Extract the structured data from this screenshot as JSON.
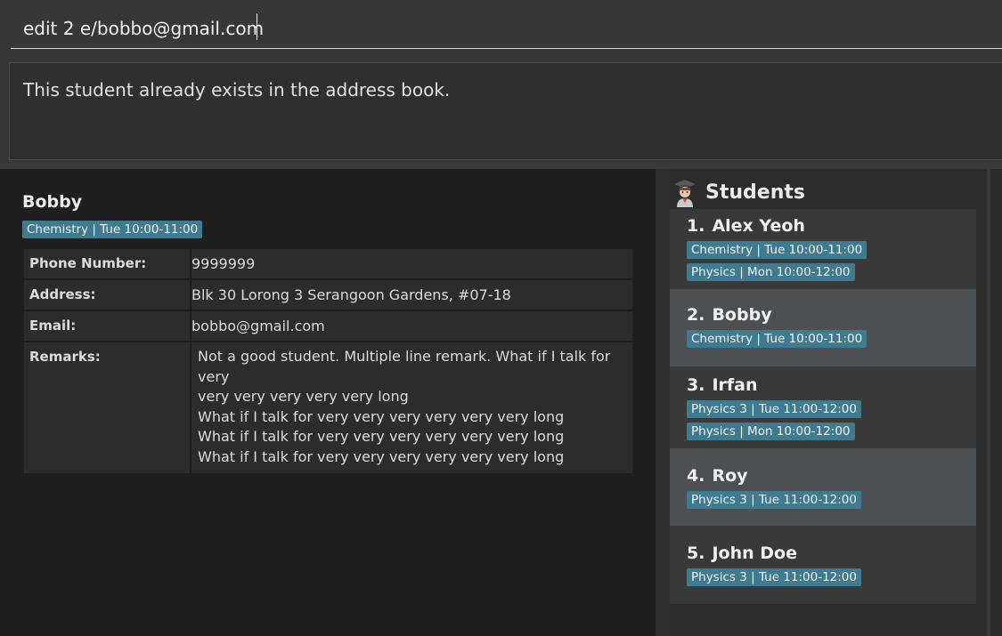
{
  "command": {
    "value": "edit 2 e/bobbo@gmail.com"
  },
  "result": {
    "message": "This student already exists in the address book."
  },
  "details": {
    "name": "Bobby",
    "tag": "Chemistry | Tue 10:00-11:00",
    "rows": [
      {
        "label": "Phone Number:",
        "value": "9999999"
      },
      {
        "label": "Address:",
        "value": "Blk 30 Lorong 3 Serangoon Gardens, #07-18"
      },
      {
        "label": "Email:",
        "value": "bobbo@gmail.com"
      }
    ],
    "remarks_label": "Remarks:",
    "remarks_lines": [
      "Not a good student. Multiple line remark. What if I talk for very",
      "very very very very very long",
      "What if I talk for very very very very very very long",
      "What if I talk for very very very very very very long",
      "What if I talk for very very very very very very long"
    ]
  },
  "students": {
    "title": "Students",
    "icon": "graduate-student-icon",
    "items": [
      {
        "index": "1.",
        "name": "Alex Yeoh",
        "tags": [
          "Chemistry | Tue 10:00-11:00",
          "Physics | Mon 10:00-12:00"
        ]
      },
      {
        "index": "2.",
        "name": "Bobby",
        "tags": [
          "Chemistry | Tue 10:00-11:00"
        ]
      },
      {
        "index": "3.",
        "name": "Irfan",
        "tags": [
          "Physics 3 | Tue 11:00-12:00",
          "Physics | Mon 10:00-12:00"
        ]
      },
      {
        "index": "4.",
        "name": "Roy",
        "tags": [
          "Physics 3 | Tue 11:00-12:00"
        ]
      },
      {
        "index": "5.",
        "name": "John Doe",
        "tags": [
          "Physics 3 | Tue 11:00-12:00"
        ]
      }
    ]
  },
  "colors": {
    "tag_bg": "#3e7b91",
    "card_odd": "#393939",
    "card_even": "#4c5052"
  }
}
